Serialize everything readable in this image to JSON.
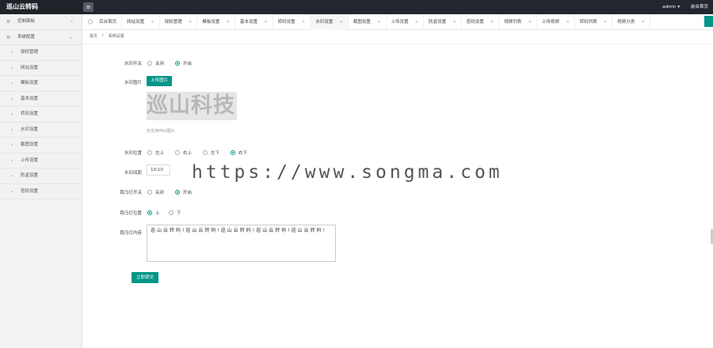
{
  "app": {
    "title": "巡山云转码",
    "user": "admin",
    "front_link": "前台首页"
  },
  "sidebar": {
    "top": [
      {
        "label": "控制面板"
      },
      {
        "label": "系统配置"
      }
    ],
    "items": [
      {
        "label": "授权管理"
      },
      {
        "label": "网站设置"
      },
      {
        "label": "模板设置"
      },
      {
        "label": "基本设置"
      },
      {
        "label": "转码设置"
      },
      {
        "label": "水印设置"
      },
      {
        "label": "截图设置"
      },
      {
        "label": "上传设置"
      },
      {
        "label": "防盗设置"
      },
      {
        "label": "密码设置"
      }
    ]
  },
  "tabs": [
    {
      "label": "后台首页"
    },
    {
      "label": "网站设置"
    },
    {
      "label": "授权管理"
    },
    {
      "label": "模板设置"
    },
    {
      "label": "基本设置"
    },
    {
      "label": "转码设置"
    },
    {
      "label": "水印设置"
    },
    {
      "label": "截图设置"
    },
    {
      "label": "上传设置"
    },
    {
      "label": "防盗设置"
    },
    {
      "label": "密码设置"
    },
    {
      "label": "视频列表"
    },
    {
      "label": "上传视频"
    },
    {
      "label": "转码列表"
    },
    {
      "label": "视频分类"
    }
  ],
  "breadcrumb": {
    "home": "首页",
    "sep": "/",
    "current": "系统设置"
  },
  "form": {
    "watermark_switch": {
      "label": "水印开关",
      "off": "关闭",
      "on": "开启",
      "selected": "on"
    },
    "watermark_image": {
      "label": "水印图片",
      "button": "上传图片",
      "preview_text": "巡山科技",
      "hint": "仅支持PNG图片"
    },
    "watermark_position": {
      "label": "水印位置",
      "options": [
        "左上",
        "右上",
        "左下",
        "右下"
      ],
      "selected": "右下"
    },
    "watermark_margin": {
      "label": "水印间距",
      "value": "10:10"
    },
    "marquee_switch": {
      "label": "跑马灯开关",
      "off": "关闭",
      "on": "开启",
      "selected": "on"
    },
    "marquee_position": {
      "label": "跑马灯位置",
      "options": [
        "上",
        "下"
      ],
      "selected": "上"
    },
    "marquee_content": {
      "label": "跑马灯内容",
      "value": "巡山云转码!巡山云转码!巡山云转码!巡山云转码!巡山云转码!"
    },
    "submit": "立即提交"
  },
  "overlay_text": "https://www.songma.com",
  "colors": {
    "accent": "#009688",
    "topbar": "#23262e"
  }
}
